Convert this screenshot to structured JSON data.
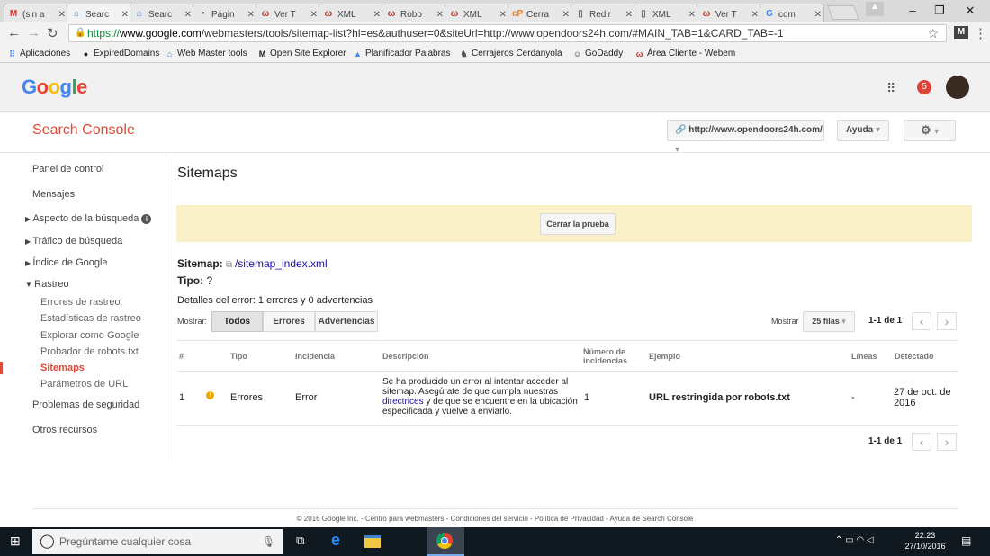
{
  "browser": {
    "tabs": [
      {
        "label": "(sin a",
        "icon": "gmail-icon"
      },
      {
        "label": "Searc",
        "icon": "search-console-icon",
        "active": true
      },
      {
        "label": "Searc",
        "icon": "search-console-icon"
      },
      {
        "label": "Págin",
        "icon": "pagespeed-icon"
      },
      {
        "label": "Ver T",
        "icon": "webempresa-icon"
      },
      {
        "label": "XML",
        "icon": "webempresa-icon"
      },
      {
        "label": "Robo",
        "icon": "webempresa-icon"
      },
      {
        "label": "XML",
        "icon": "webempresa-icon"
      },
      {
        "label": "Cerra",
        "icon": "cpanel-icon"
      },
      {
        "label": "Redir",
        "icon": "doc-icon"
      },
      {
        "label": "XML",
        "icon": "doc-icon"
      },
      {
        "label": "Ver T",
        "icon": "webempresa-icon"
      },
      {
        "label": "com",
        "icon": "google-icon"
      }
    ],
    "url_prefix": "https://",
    "url_domain": "www.google.com",
    "url_rest": "/webmasters/tools/sitemap-list?hl=es&authuser=0&siteUrl=http://www.opendoors24h.com/#MAIN_TAB=1&CARD_TAB=-1",
    "bookmarks": [
      {
        "label": "Aplicaciones",
        "icon": "apps-grid-icon"
      },
      {
        "label": "ExpiredDomains",
        "icon": "expireddomains-icon"
      },
      {
        "label": "Web Master tools",
        "icon": "search-console-icon"
      },
      {
        "label": "Open Site Explorer",
        "icon": "moz-icon"
      },
      {
        "label": "Planificador Palabras",
        "icon": "adwords-icon"
      },
      {
        "label": "Cerrajeros Cerdanyola",
        "icon": "site-icon"
      },
      {
        "label": "GoDaddy",
        "icon": "godaddy-icon"
      },
      {
        "label": "Área Cliente - Webem",
        "icon": "webempresa-icon"
      }
    ]
  },
  "header": {
    "logo": "Google",
    "notifications": "5",
    "product": "Search Console",
    "site_selector": "http://www.opendoors24h.com/",
    "help": "Ayuda"
  },
  "sidebar": {
    "items": [
      {
        "label": "Panel de control"
      },
      {
        "label": "Mensajes"
      },
      {
        "label": "Aspecto de la búsqueda"
      },
      {
        "label": "Tráfico de búsqueda"
      },
      {
        "label": "Índice de Google"
      },
      {
        "label": "Rastreo"
      },
      {
        "label": "Errores de rastreo"
      },
      {
        "label": "Estadísticas de rastreo"
      },
      {
        "label": "Explorar como Google"
      },
      {
        "label": "Probador de robots.txt"
      },
      {
        "label": "Sitemaps"
      },
      {
        "label": "Parámetros de URL"
      },
      {
        "label": "Problemas de seguridad"
      },
      {
        "label": "Otros recursos"
      }
    ]
  },
  "main": {
    "title": "Sitemaps",
    "close_test_button": "Cerrar la prueba",
    "sitemap_label": "Sitemap:",
    "sitemap_link": "/sitemap_index.xml",
    "type_label": "Tipo:",
    "type_value": "?",
    "error_details_label": "Detalles del error:",
    "error_details_value": "1 errores y 0 advertencias",
    "show_label": "Mostrar:",
    "filters": [
      "Todos",
      "Errores",
      "Advertencias"
    ],
    "rows_label": "Mostrar",
    "rows_value": "25 filas",
    "pagination": "1-1 de 1",
    "table": {
      "headers": [
        "#",
        "Tipo",
        "Incidencia",
        "Descripción",
        "Número de incidencias",
        "Ejemplo",
        "Líneas",
        "Detectado"
      ],
      "rows": [
        {
          "num": "1",
          "tipo": "Errores",
          "incidencia": "Error",
          "desc_before": "Se ha producido un error al intentar acceder al sitemap. Asegúrate de que cumpla nuestras ",
          "desc_link": "directrices",
          "desc_after": " y de que se encuentre en la ubicación especificada y vuelve a enviarlo.",
          "incidencias": "1",
          "ejemplo": "URL restringida por robots.txt",
          "lineas": "-",
          "detectado": "27 de oct. de 2016"
        }
      ]
    }
  },
  "footer": {
    "text": "© 2016 Google Inc. - Centro para webmasters - Condiciones del servicio - Política de Privacidad - Ayuda de Search Console"
  },
  "taskbar": {
    "search_placeholder": "Pregúntame cualquier cosa",
    "time": "22:23",
    "date": "27/10/2016"
  },
  "colors": {
    "accent_red": "#dd4b39",
    "banner_yellow": "#fbf1c8",
    "link_blue": "#1a0dab"
  }
}
